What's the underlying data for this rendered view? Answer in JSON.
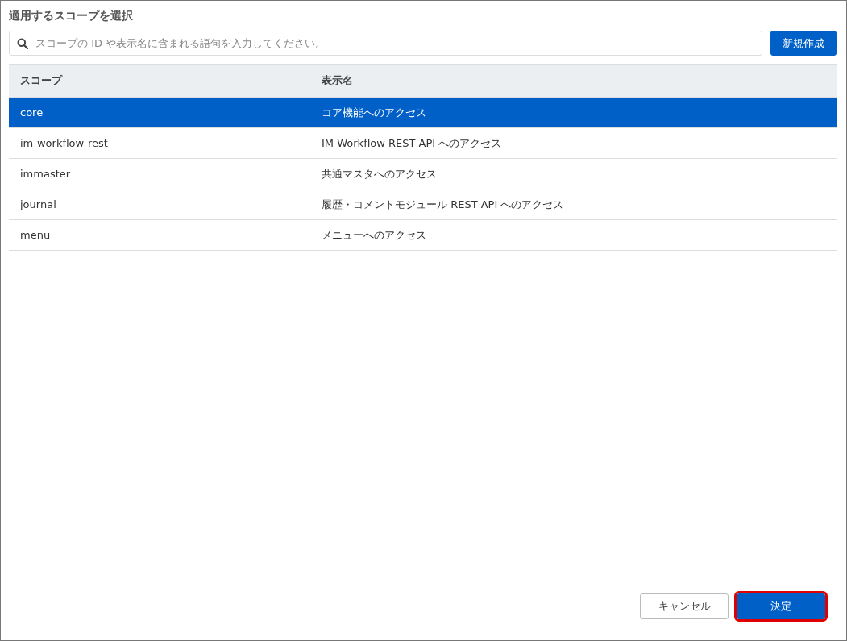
{
  "dialog": {
    "title": "適用するスコープを選択"
  },
  "search": {
    "placeholder": "スコープの ID や表示名に含まれる語句を入力してください。"
  },
  "create_button": {
    "label": "新規作成"
  },
  "table": {
    "columns": [
      "スコープ",
      "表示名"
    ],
    "rows": [
      {
        "scope": "core",
        "display_name": "コア機能へのアクセス",
        "selected": true
      },
      {
        "scope": "im-workflow-rest",
        "display_name": "IM-Workflow REST API へのアクセス",
        "selected": false
      },
      {
        "scope": "immaster",
        "display_name": "共通マスタへのアクセス",
        "selected": false
      },
      {
        "scope": "journal",
        "display_name": "履歴・コメントモジュール REST API へのアクセス",
        "selected": false
      },
      {
        "scope": "menu",
        "display_name": "メニューへのアクセス",
        "selected": false
      }
    ]
  },
  "footer_buttons": [
    {
      "kind": "secondary",
      "label": "キャンセル",
      "highlighted": false
    },
    {
      "kind": "primary",
      "label": "決定",
      "highlighted": true
    }
  ]
}
